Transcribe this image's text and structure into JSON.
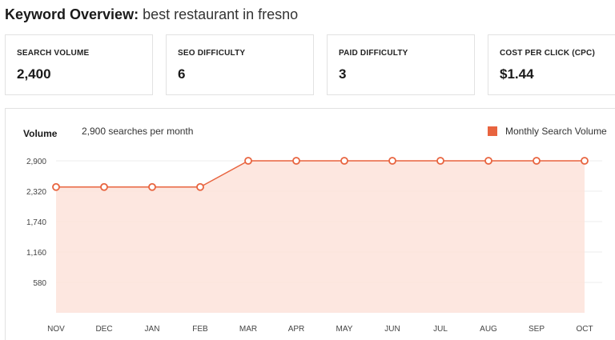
{
  "header": {
    "label": "Keyword Overview:",
    "keyword": "best restaurant in fresno"
  },
  "metrics": [
    {
      "label": "SEARCH VOLUME",
      "value": "2,400"
    },
    {
      "label": "SEO DIFFICULTY",
      "value": "6"
    },
    {
      "label": "PAID DIFFICULTY",
      "value": "3"
    },
    {
      "label": "COST PER CLICK (CPC)",
      "value": "$1.44"
    }
  ],
  "chart_header": {
    "volume_label": "Volume",
    "volume_text": "2,900 searches per month"
  },
  "colors": {
    "accent": "#e8643f",
    "fill": "#fde3da"
  },
  "chart_data": {
    "type": "area",
    "categories": [
      "NOV",
      "DEC",
      "JAN",
      "FEB",
      "MAR",
      "APR",
      "MAY",
      "JUN",
      "JUL",
      "AUG",
      "SEP",
      "OCT"
    ],
    "series": [
      {
        "name": "Monthly Search Volume",
        "values": [
          2400,
          2400,
          2400,
          2400,
          2900,
          2900,
          2900,
          2900,
          2900,
          2900,
          2900,
          2900
        ]
      }
    ],
    "yticks": [
      "2,900",
      "2,320",
      "1,740",
      "1,160",
      "580"
    ],
    "ytick_values": [
      2900,
      2320,
      1740,
      1160,
      580
    ],
    "ylim": [
      0,
      2900
    ],
    "grid": true,
    "legend": "top-right"
  }
}
